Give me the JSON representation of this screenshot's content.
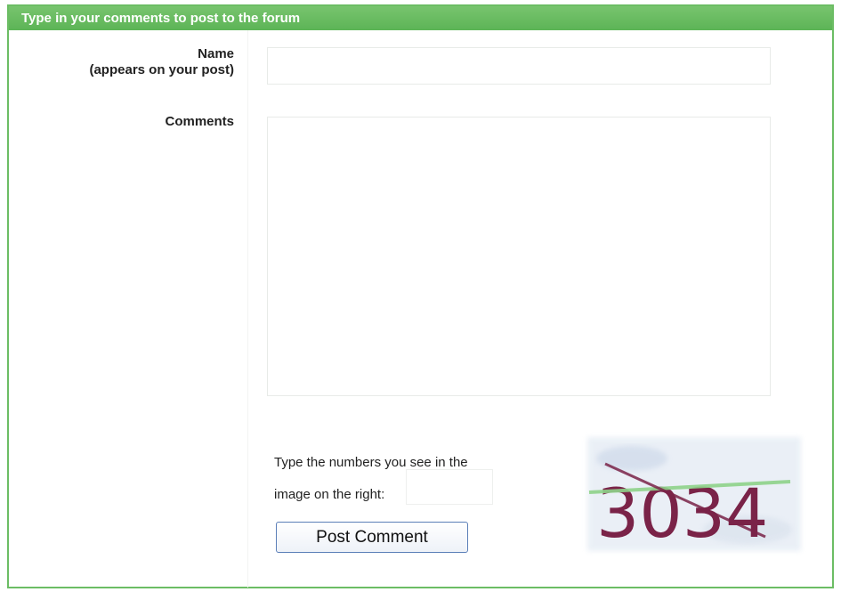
{
  "form": {
    "header": "Type in your comments to post to the forum",
    "name_label_line1": "Name",
    "name_label_line2": "(appears on your post)",
    "name_value": "",
    "comments_label": "Comments",
    "comments_value": "",
    "captcha_prompt_line1": "Type the numbers you see in the",
    "captcha_prompt_line2": "image on the right:",
    "captcha_value": "",
    "captcha_text": "3034",
    "submit_label": "Post Comment"
  },
  "colors": {
    "header_green": "#5cb456",
    "border_green": "#6cbd64",
    "captcha_digits": "#7a2348",
    "captcha_line_green": "#8fd38a",
    "button_border": "#5b7fb8"
  }
}
